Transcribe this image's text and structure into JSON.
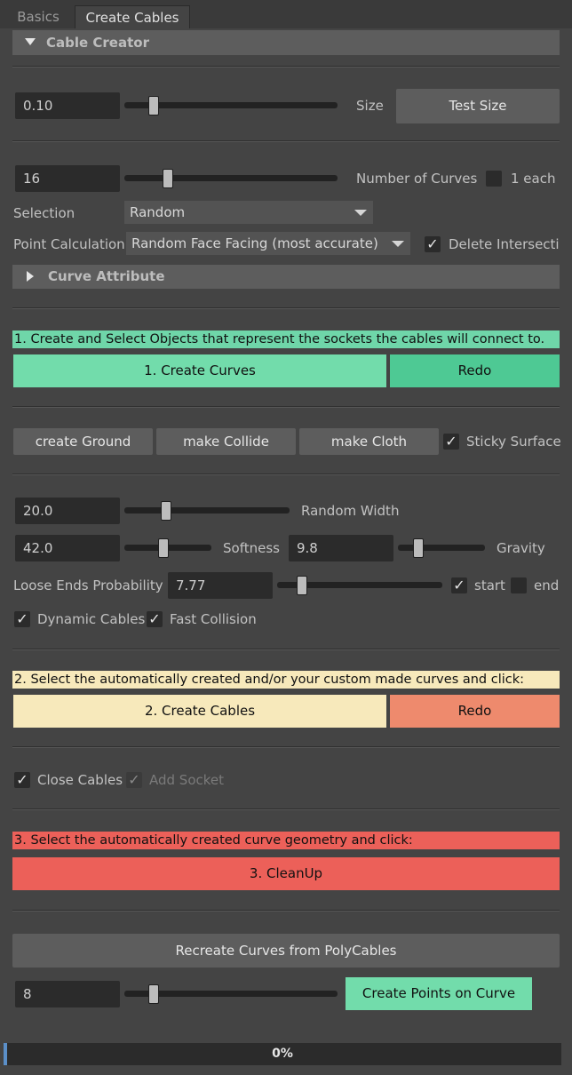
{
  "tabs": [
    {
      "label": "Basics"
    },
    {
      "label": "Create Cables"
    }
  ],
  "cable_creator": {
    "title": "Cable Creator",
    "size": {
      "value": "0.10",
      "label": "Size",
      "slider_level": 0.08,
      "test_button": "Test Size"
    },
    "curves": {
      "value": "16",
      "label": "Number of Curves",
      "slider_level": 0.16,
      "one_each_label": "1 each",
      "one_each_checked": false
    },
    "selection": {
      "label": "Selection",
      "value": "Random"
    },
    "point_calc": {
      "label": "Point Calculation",
      "value": "Random Face Facing (most accurate)",
      "delete_intersecting_label": "Delete Intersecting",
      "delete_intersecting_checked": true
    },
    "curve_attribute_title": "Curve Attribute"
  },
  "step1": {
    "instruction": "1. Create and Select Objects that represent the sockets the cables will connect to.",
    "create_label": "1. Create Curves",
    "redo_label": "Redo"
  },
  "dynamics": {
    "create_ground": "create Ground",
    "make_collide": "make Collide",
    "make_cloth": "make Cloth",
    "sticky_surface": "Sticky Surface",
    "random_width": {
      "value": "20.0",
      "label": "Random Width",
      "slider_level": 0.2
    },
    "softness": {
      "value": "42.0",
      "label": "Softness",
      "slider_level": 0.42
    },
    "gravity": {
      "value": "9.8",
      "label": "Gravity",
      "slider_level": 0.1
    },
    "loose_ends": {
      "label": "Loose Ends Probability",
      "value": "7.77",
      "slider_level": 0.08,
      "start_label": "start",
      "end_label": "end"
    },
    "dynamic_cables": "Dynamic Cables",
    "fast_collision": "Fast Collision"
  },
  "step2": {
    "instruction": "2. Select the automatically created and/or your custom made curves and click:",
    "create_label": "2. Create Cables",
    "redo_label": "Redo"
  },
  "close_options": {
    "close_cables": "Close Cables",
    "add_socket": "Add Socket"
  },
  "step3": {
    "instruction": "3. Select the automatically created curve geometry and click:",
    "cleanup_label": "3. CleanUp"
  },
  "tools": {
    "recreate_label": "Recreate Curves from PolyCables",
    "points_value": "8",
    "points_slider_level": 0.08,
    "create_points_label": "Create Points on Curve"
  },
  "progress": {
    "text": "0%",
    "value": 0
  },
  "colors": {
    "green_strip": "#6fd6a9",
    "green_button": "#72dcab",
    "green_redo": "#4ec994",
    "yellow": "#f7e9bb",
    "salmon": "#ee8a6d",
    "red": "#ec6059"
  }
}
